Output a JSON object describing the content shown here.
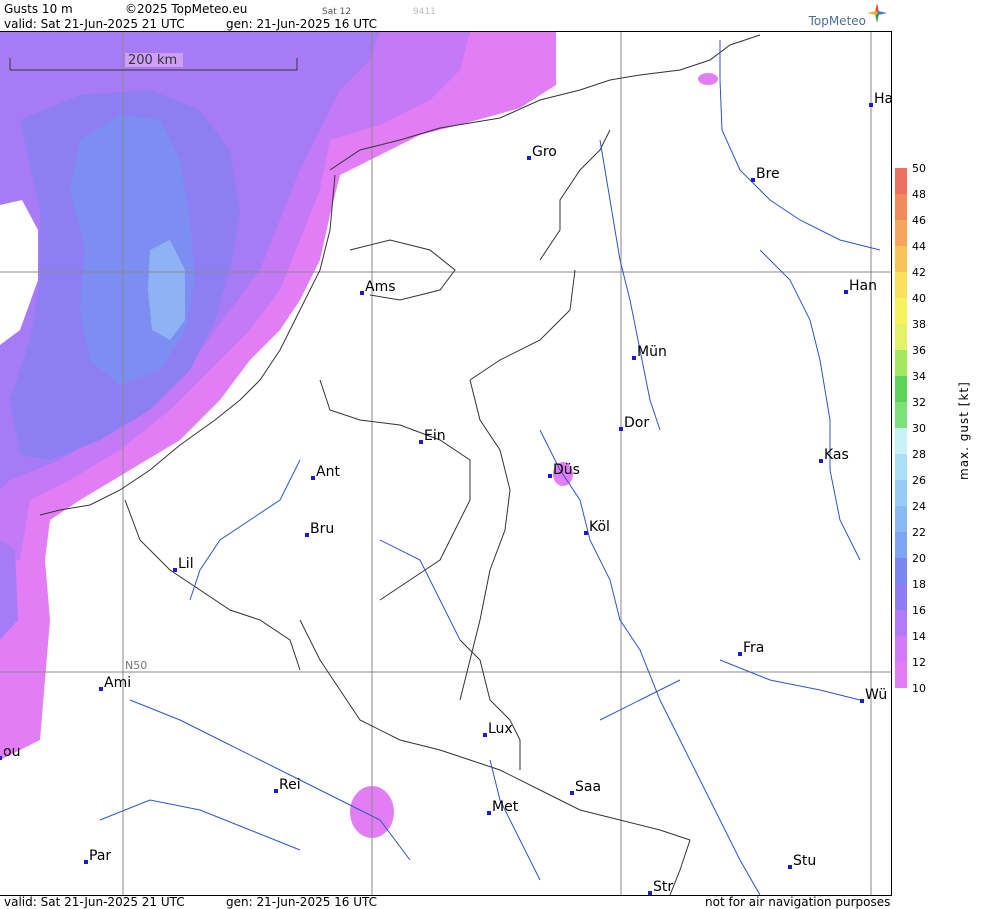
{
  "header": {
    "title": "Gusts 10 m",
    "copyright": "©2025 TopMeteo.eu",
    "sat": "Sat 12",
    "code": "9411",
    "valid": "valid:  Sat  21-Jun-2025  21 UTC",
    "gen": "gen: 21-Jun-2025 16 UTC",
    "brand": "TopMeteo"
  },
  "map": {
    "scale_label": "200 km",
    "lat_label": "N50",
    "cities": [
      {
        "id": "ha",
        "label": "Ha"
      },
      {
        "id": "gro",
        "label": "Gro"
      },
      {
        "id": "bre",
        "label": "Bre"
      },
      {
        "id": "ams",
        "label": "Ams"
      },
      {
        "id": "han",
        "label": "Han"
      },
      {
        "id": "mun",
        "label": "Mün"
      },
      {
        "id": "dor",
        "label": "Dor"
      },
      {
        "id": "ein",
        "label": "Ein"
      },
      {
        "id": "dus",
        "label": "Düs"
      },
      {
        "id": "kas",
        "label": "Kas"
      },
      {
        "id": "ant",
        "label": "Ant"
      },
      {
        "id": "kol",
        "label": "Köl"
      },
      {
        "id": "bru",
        "label": "Bru"
      },
      {
        "id": "lil",
        "label": "Lil"
      },
      {
        "id": "fra",
        "label": "Fra"
      },
      {
        "id": "ami",
        "label": "Ami"
      },
      {
        "id": "wu",
        "label": "Wü"
      },
      {
        "id": "lux",
        "label": "Lux"
      },
      {
        "id": "rou",
        "label": "ou"
      },
      {
        "id": "rei",
        "label": "Rei"
      },
      {
        "id": "saa",
        "label": "Saa"
      },
      {
        "id": "met",
        "label": "Met"
      },
      {
        "id": "par",
        "label": "Par"
      },
      {
        "id": "stu",
        "label": "Stu"
      },
      {
        "id": "str",
        "label": "Str"
      }
    ]
  },
  "legend": {
    "title": "max. gust [kt]",
    "ticks": [
      "50",
      "48",
      "46",
      "44",
      "42",
      "40",
      "38",
      "36",
      "34",
      "32",
      "30",
      "28",
      "26",
      "24",
      "22",
      "20",
      "18",
      "16",
      "14",
      "12",
      "10"
    ],
    "colors": {
      "12": "#e27ef5",
      "14": "#d27af7",
      "16": "#b37af7",
      "18": "#8f7cf5",
      "20": "#7a86f2",
      "22": "#7ea6f3",
      "24": "#88baf5",
      "26": "#98ccf8",
      "28": "#abdff8",
      "30": "#c8f2f8",
      "32": "#7ee07a",
      "34": "#5ed35a",
      "36": "#a3e85e",
      "38": "#e4f26a",
      "40": "#f6f45a",
      "42": "#f8e05a",
      "44": "#f8c45a",
      "46": "#f6a65a",
      "48": "#f28a5a",
      "50": "#ee7060"
    }
  },
  "footer": {
    "valid": "valid:  Sat  21-Jun-2025  21 UTC",
    "gen": "gen: 21-Jun-2025 16 UTC",
    "note": "not for air navigation purposes"
  }
}
